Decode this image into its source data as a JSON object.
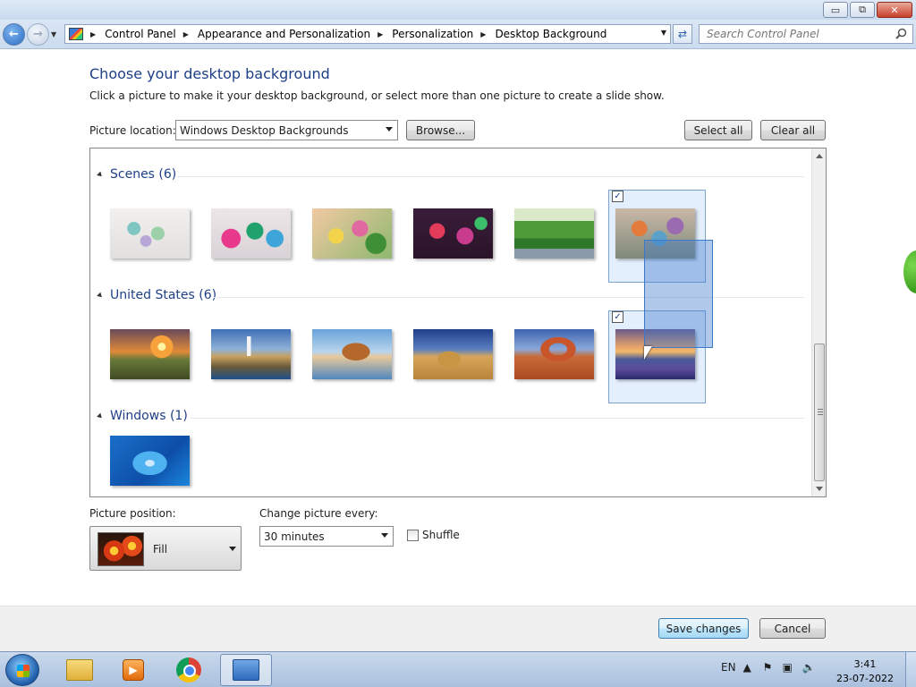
{
  "window": {
    "minimize_glyph": "▭",
    "maximize_glyph": "⧉",
    "close_glyph": "✕"
  },
  "address": {
    "crumbs": [
      "Control Panel",
      "Appearance and Personalization",
      "Personalization",
      "Desktop Background"
    ],
    "search_placeholder": "Search Control Panel"
  },
  "page": {
    "title": "Choose your desktop background",
    "subtitle": "Click a picture to make it your desktop background, or select more than one picture to create a slide show.",
    "picture_location_label": "Picture location:",
    "picture_location_value": "Windows Desktop Backgrounds",
    "browse_label": "Browse...",
    "select_all_label": "Select all",
    "clear_all_label": "Clear all"
  },
  "gallery": {
    "groups": [
      {
        "name": "Scenes (6)",
        "selected_index": 5,
        "count": 6
      },
      {
        "name": "United States (6)",
        "selected_index": 5,
        "count": 6
      },
      {
        "name": "Windows (1)",
        "selected_index": -1,
        "count": 1
      }
    ],
    "check_glyph": "✓"
  },
  "options": {
    "position_label": "Picture position:",
    "position_value": "Fill",
    "change_label": "Change picture every:",
    "change_value": "30 minutes",
    "shuffle_label": "Shuffle",
    "shuffle_checked": false
  },
  "footer": {
    "save_label": "Save changes",
    "cancel_label": "Cancel"
  },
  "taskbar": {
    "language": "EN",
    "time": "3:41",
    "date": "23-07-2022"
  },
  "colors": {
    "title_blue": "#1e3f87",
    "selection_fill": "#cce2fc",
    "drag_fill": "#3a78cd"
  }
}
